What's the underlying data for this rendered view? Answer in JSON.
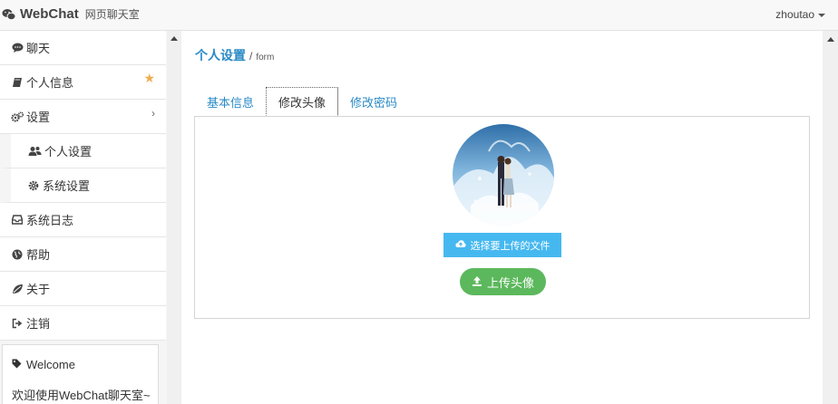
{
  "app": {
    "name": "WebChat",
    "subtitle": "网页聊天室"
  },
  "header": {
    "username": "zhoutao"
  },
  "sidebar": {
    "items": [
      {
        "label": "聊天",
        "icon": "comment-icon"
      },
      {
        "label": "个人信息",
        "icon": "book-icon",
        "badge": "star-icon"
      },
      {
        "label": "设置",
        "icon": "gears-icon",
        "expand": "chevron-right-icon"
      },
      {
        "label": "个人设置",
        "icon": "users-icon",
        "sub": true
      },
      {
        "label": "系统设置",
        "icon": "gear-icon",
        "sub": true
      },
      {
        "label": "系统日志",
        "icon": "inbox-icon"
      },
      {
        "label": "帮助",
        "icon": "globe-icon"
      },
      {
        "label": "关于",
        "icon": "leaf-icon"
      },
      {
        "label": "注销",
        "icon": "sign-out-icon"
      }
    ],
    "welcome": {
      "title": "Welcome",
      "text": "欢迎使用WebChat聊天室~"
    }
  },
  "breadcrumb": {
    "title": "个人设置",
    "separator": "/",
    "sub": "form"
  },
  "tabs": [
    {
      "label": "基本信息",
      "active": false
    },
    {
      "label": "修改头像",
      "active": true
    },
    {
      "label": "修改密码",
      "active": false
    }
  ],
  "avatar_form": {
    "choose_label": "选择要上传的文件",
    "upload_label": "上传头像"
  },
  "colors": {
    "link": "#2a8ac6",
    "choose_button": "#46b8f0",
    "upload_button": "#5cb85c",
    "star": "#f0ad4e"
  }
}
